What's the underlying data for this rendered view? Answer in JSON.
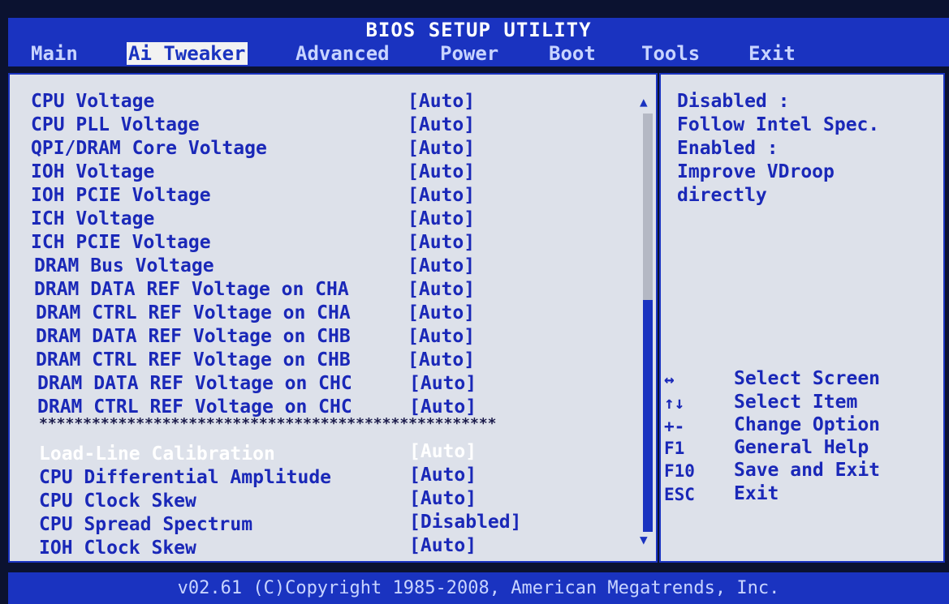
{
  "title": "BIOS SETUP UTILITY",
  "menu": [
    "Main",
    "Ai Tweaker",
    "Advanced",
    "Power",
    "Boot",
    "Tools",
    "Exit"
  ],
  "settings_top": [
    {
      "label": "CPU Voltage",
      "value": "[Auto]"
    },
    {
      "label": "CPU PLL Voltage",
      "value": "[Auto]"
    },
    {
      "label": "QPI/DRAM Core Voltage",
      "value": "[Auto]"
    },
    {
      "label": "IOH Voltage",
      "value": "[Auto]"
    },
    {
      "label": "IOH PCIE Voltage",
      "value": "[Auto]"
    },
    {
      "label": "ICH Voltage",
      "value": "[Auto]"
    },
    {
      "label": "ICH PCIE Voltage",
      "value": "[Auto]"
    },
    {
      "label": "DRAM Bus Voltage",
      "value": "[Auto]"
    },
    {
      "label": "DRAM DATA REF Voltage on CHA",
      "value": "[Auto]"
    },
    {
      "label": "DRAM CTRL REF Voltage on CHA",
      "value": "[Auto]"
    },
    {
      "label": "DRAM DATA REF Voltage on CHB",
      "value": "[Auto]"
    },
    {
      "label": "DRAM CTRL REF Voltage on CHB",
      "value": "[Auto]"
    },
    {
      "label": "DRAM DATA REF Voltage on CHC",
      "value": "[Auto]"
    },
    {
      "label": "DRAM CTRL REF Voltage on CHC",
      "value": "[Auto]"
    }
  ],
  "separator": "****************************************************",
  "settings_bottom": [
    {
      "label": "Load-Line Calibration",
      "value": "[Auto]"
    },
    {
      "label": "CPU Differential Amplitude",
      "value": "[Auto]"
    },
    {
      "label": "CPU Clock Skew",
      "value": "[Auto]"
    },
    {
      "label": "CPU Spread Spectrum",
      "value": "[Disabled]"
    },
    {
      "label": "IOH Clock Skew",
      "value": "[Auto]"
    }
  ],
  "help": [
    "Disabled :",
    "Follow Intel Spec.",
    "Enabled :",
    "Improve VDroop",
    "directly"
  ],
  "keys": [
    {
      "key": "↔",
      "desc": "Select Screen"
    },
    {
      "key": "↑↓",
      "desc": "Select Item"
    },
    {
      "key": "+-",
      "desc": "Change Option"
    },
    {
      "key": "F1",
      "desc": "General Help"
    },
    {
      "key": "F10",
      "desc": "Save and Exit"
    },
    {
      "key": "ESC",
      "desc": "Exit"
    }
  ],
  "scroll_up": "▲",
  "scroll_down": "▼",
  "footer": "v02.61 (C)Copyright 1985-2008, American Megatrends, Inc."
}
